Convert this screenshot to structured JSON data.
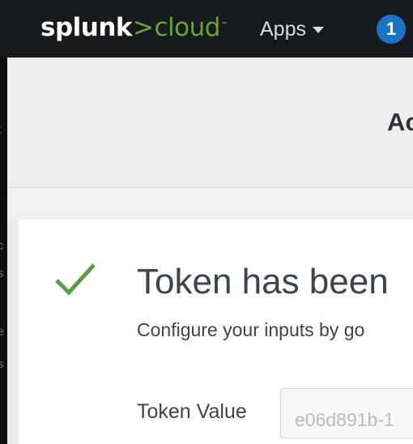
{
  "topbar": {
    "logo_word": "splunk",
    "logo_chevron": ">",
    "logo_product": "cloud",
    "logo_tm": "™",
    "apps_label": "Apps",
    "notification_count": "1"
  },
  "side_fragments": [
    "t",
    "c",
    "s",
    "e",
    "s"
  ],
  "header": {
    "title_fragment": "Ac"
  },
  "success": {
    "title": "Token has been",
    "subtitle": "Configure your inputs by go",
    "token_label": "Token Value",
    "token_value": "e06d891b-1"
  },
  "colors": {
    "accent_green": "#65a637",
    "badge_blue": "#1a73c4",
    "topbar_bg": "#171a1d"
  },
  "icons": [
    "chevron-down-icon",
    "checkmark-icon"
  ]
}
